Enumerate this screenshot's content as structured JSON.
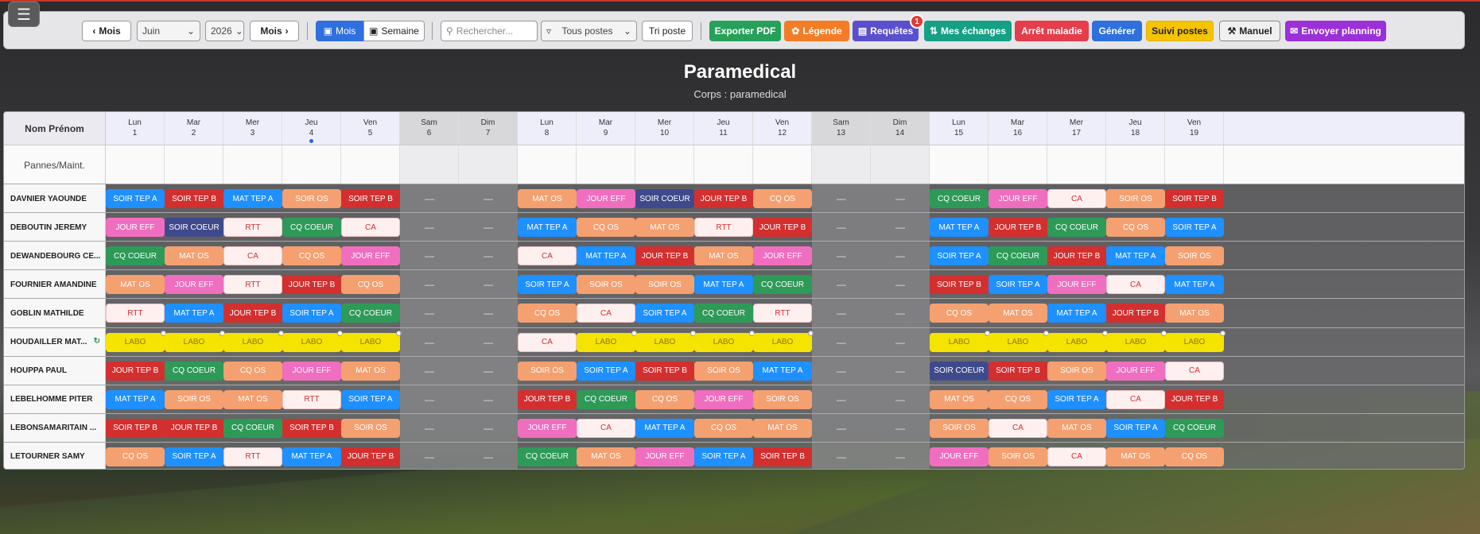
{
  "toolbar": {
    "prev_label": "Mois",
    "month_value": "Juin",
    "year_value": "2026",
    "next_label": "Mois",
    "view_month": "Mois",
    "view_week": "Semaine",
    "search_placeholder": "Rechercher...",
    "filter_value": "Tous postes",
    "sort_label": "Tri poste",
    "export_label": "Exporter PDF",
    "legend_label": "Légende",
    "requests_label": "Requêtes",
    "requests_count": "1",
    "exchanges_label": "Mes échanges",
    "sick_label": "Arrêt maladie",
    "generate_label": "Générer",
    "tracking_label": "Suivi postes",
    "manual_label": "Manuel",
    "send_label": "Envoyer planning"
  },
  "page": {
    "title": "Paramedical",
    "subtitle": "Corps : paramedical"
  },
  "grid": {
    "name_header": "Nom Prénom",
    "pannes_label": "Pannes/Maint.",
    "days": [
      {
        "dow": "Lun",
        "num": "1",
        "we": false
      },
      {
        "dow": "Mar",
        "num": "2",
        "we": false
      },
      {
        "dow": "Mer",
        "num": "3",
        "we": false
      },
      {
        "dow": "Jeu",
        "num": "4",
        "we": false,
        "today": true
      },
      {
        "dow": "Ven",
        "num": "5",
        "we": false
      },
      {
        "dow": "Sam",
        "num": "6",
        "we": true
      },
      {
        "dow": "Dim",
        "num": "7",
        "we": true
      },
      {
        "dow": "Lun",
        "num": "8",
        "we": false
      },
      {
        "dow": "Mar",
        "num": "9",
        "we": false
      },
      {
        "dow": "Mer",
        "num": "10",
        "we": false
      },
      {
        "dow": "Jeu",
        "num": "11",
        "we": false
      },
      {
        "dow": "Ven",
        "num": "12",
        "we": false
      },
      {
        "dow": "Sam",
        "num": "13",
        "we": true
      },
      {
        "dow": "Dim",
        "num": "14",
        "we": true
      },
      {
        "dow": "Lun",
        "num": "15",
        "we": false
      },
      {
        "dow": "Mar",
        "num": "16",
        "we": false
      },
      {
        "dow": "Mer",
        "num": "17",
        "we": false
      },
      {
        "dow": "Jeu",
        "num": "18",
        "we": false
      },
      {
        "dow": "Ven",
        "num": "19",
        "we": false
      }
    ],
    "colors": {
      "SOIR TEP A": "#1e90ff",
      "SOIR TEP B": "#d32f2f",
      "MAT TEP A": "#1e90ff",
      "SOIR OS": "#f4a070",
      "MAT OS": "#f4a070",
      "CQ OS": "#f4a070",
      "JOUR EFF": "#f06ebf",
      "SOIR COEUR": "#3f4a8c",
      "JOUR TEP B": "#d32f2f",
      "CQ COEUR": "#2e9a58",
      "RTT": "#fff0f0",
      "CA": "#fff0f0",
      "LABO": "#f5e400"
    },
    "rows": [
      {
        "name": "DAVNIER YAOUNDE",
        "cells": [
          "SOIR TEP A",
          "SOIR TEP B",
          "MAT TEP A",
          "SOIR OS",
          "SOIR TEP B",
          "—",
          "—",
          "MAT OS",
          "JOUR EFF",
          "SOIR COEUR",
          "JOUR TEP B",
          "CQ OS",
          "—",
          "—",
          "CQ COEUR",
          "JOUR EFF",
          "CA",
          "SOIR OS",
          "SOIR TEP B"
        ]
      },
      {
        "name": "DEBOUTIN JEREMY",
        "cells": [
          "JOUR EFF",
          "SOIR COEUR",
          "RTT",
          "CQ COEUR",
          "CA",
          "—",
          "—",
          "MAT TEP A",
          "CQ OS",
          "MAT OS",
          "RTT",
          "JOUR TEP B",
          "—",
          "—",
          "MAT TEP A",
          "JOUR TEP B",
          "CQ COEUR",
          "CQ OS",
          "SOIR TEP A"
        ]
      },
      {
        "name": "DEWANDEBOURG CE...",
        "cells": [
          "CQ COEUR",
          "MAT OS",
          "CA",
          "CQ OS",
          "JOUR EFF",
          "—",
          "—",
          "CA",
          "MAT TEP A",
          "JOUR TEP B",
          "MAT OS",
          "JOUR EFF",
          "—",
          "—",
          "SOIR TEP A",
          "CQ COEUR",
          "JOUR TEP B",
          "MAT TEP A",
          "SOIR OS"
        ]
      },
      {
        "name": "FOURNIER AMANDINE",
        "cells": [
          "MAT OS",
          "JOUR EFF",
          "RTT",
          "JOUR TEP B",
          "CQ OS",
          "—",
          "—",
          "SOIR TEP A",
          "SOIR OS",
          "SOIR OS",
          "MAT TEP A",
          "CQ COEUR",
          "—",
          "—",
          "SOIR TEP B",
          "SOIR TEP A",
          "JOUR EFF",
          "CA",
          "MAT TEP A"
        ]
      },
      {
        "name": "GOBLIN MATHILDE",
        "cells": [
          "RTT",
          "MAT TEP A",
          "JOUR TEP B",
          "SOIR TEP A",
          "CQ COEUR",
          "—",
          "—",
          "CQ OS",
          "CA",
          "SOIR TEP A",
          "CQ COEUR",
          "RTT",
          "—",
          "—",
          "CQ OS",
          "MAT OS",
          "MAT TEP A",
          "JOUR TEP B",
          "MAT OS"
        ]
      },
      {
        "name": "HOUDAILLER MAT...",
        "refresh": true,
        "cells": [
          "LABO",
          "LABO",
          "LABO",
          "LABO",
          "LABO",
          "—",
          "—",
          "CA",
          "LABO",
          "LABO",
          "LABO",
          "LABO",
          "—",
          "—",
          "LABO",
          "LABO",
          "LABO",
          "LABO",
          "LABO"
        ]
      },
      {
        "name": "HOUPPA PAUL",
        "cells": [
          "JOUR TEP B",
          "CQ COEUR",
          "CQ OS",
          "JOUR EFF",
          "MAT OS",
          "—",
          "—",
          "SOIR OS",
          "SOIR TEP A",
          "SOIR TEP B",
          "SOIR OS",
          "MAT TEP A",
          "—",
          "—",
          "SOIR COEUR",
          "SOIR TEP B",
          "SOIR OS",
          "JOUR EFF",
          "CA"
        ]
      },
      {
        "name": "LEBELHOMME PITER",
        "cells": [
          "MAT TEP A",
          "SOIR OS",
          "MAT OS",
          "RTT",
          "SOIR TEP A",
          "—",
          "—",
          "JOUR TEP B",
          "CQ COEUR",
          "CQ OS",
          "JOUR EFF",
          "SOIR OS",
          "—",
          "—",
          "MAT OS",
          "CQ OS",
          "SOIR TEP A",
          "CA",
          "JOUR TEP B"
        ]
      },
      {
        "name": "LEBONSAMARITAIN ...",
        "cells": [
          "SOIR TEP B",
          "JOUR TEP B",
          "CQ COEUR",
          "SOIR TEP B",
          "SOIR OS",
          "—",
          "—",
          "JOUR EFF",
          "CA",
          "MAT TEP A",
          "CQ OS",
          "MAT OS",
          "—",
          "—",
          "SOIR OS",
          "CA",
          "MAT OS",
          "SOIR TEP A",
          "CQ COEUR"
        ]
      },
      {
        "name": "LETOURNER SAMY",
        "cells": [
          "CQ OS",
          "SOIR TEP A",
          "RTT",
          "MAT TEP A",
          "JOUR TEP B",
          "—",
          "—",
          "CQ COEUR",
          "MAT OS",
          "JOUR EFF",
          "SOIR TEP A",
          "SOIR TEP B",
          "—",
          "—",
          "JOUR EFF",
          "SOIR OS",
          "CA",
          "MAT OS",
          "CQ OS"
        ]
      }
    ]
  }
}
